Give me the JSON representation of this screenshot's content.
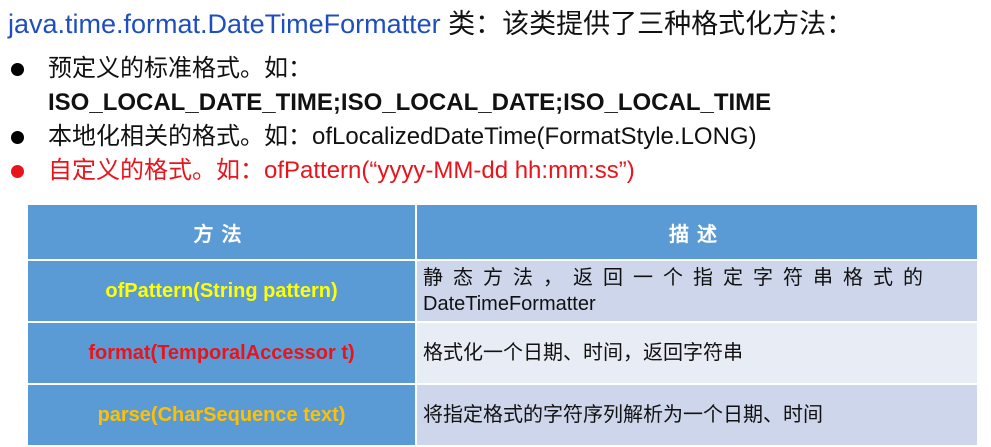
{
  "title": {
    "class_name": "java.time.format.DateTimeFormatter",
    "suffix": " 类：该类提供了三种格式化方法："
  },
  "bullets": [
    {
      "text": "预定义的标准格式。如：",
      "subtext": "ISO_LOCAL_DATE_TIME;ISO_LOCAL_DATE;ISO_LOCAL_TIME"
    },
    {
      "text": "本地化相关的格式。如：ofLocalizedDateTime(FormatStyle.LONG)"
    },
    {
      "text": "自定义的格式。如：ofPattern(“yyyy-MM-dd hh:mm:ss”)"
    }
  ],
  "table": {
    "headers": [
      "方法",
      "描述"
    ],
    "rows": [
      {
        "method": "ofPattern(String pattern)",
        "desc_line1": "静态方法，返回一个指定字符串格式的",
        "desc_line2": "DateTimeFormatter",
        "method_color": "#ffff00"
      },
      {
        "method": "format(TemporalAccessor t)",
        "desc_line1": "格式化一个日期、时间，返回字符串",
        "method_color": "#e8141b"
      },
      {
        "method": "parse(CharSequence text)",
        "desc_line1": "将指定格式的字符序列解析为一个日期、时间",
        "method_color": "#ffc000"
      }
    ]
  },
  "colors": {
    "title_class": "#1f4fbf",
    "header_bg": "#5b9bd5",
    "red": "#e8141b"
  }
}
